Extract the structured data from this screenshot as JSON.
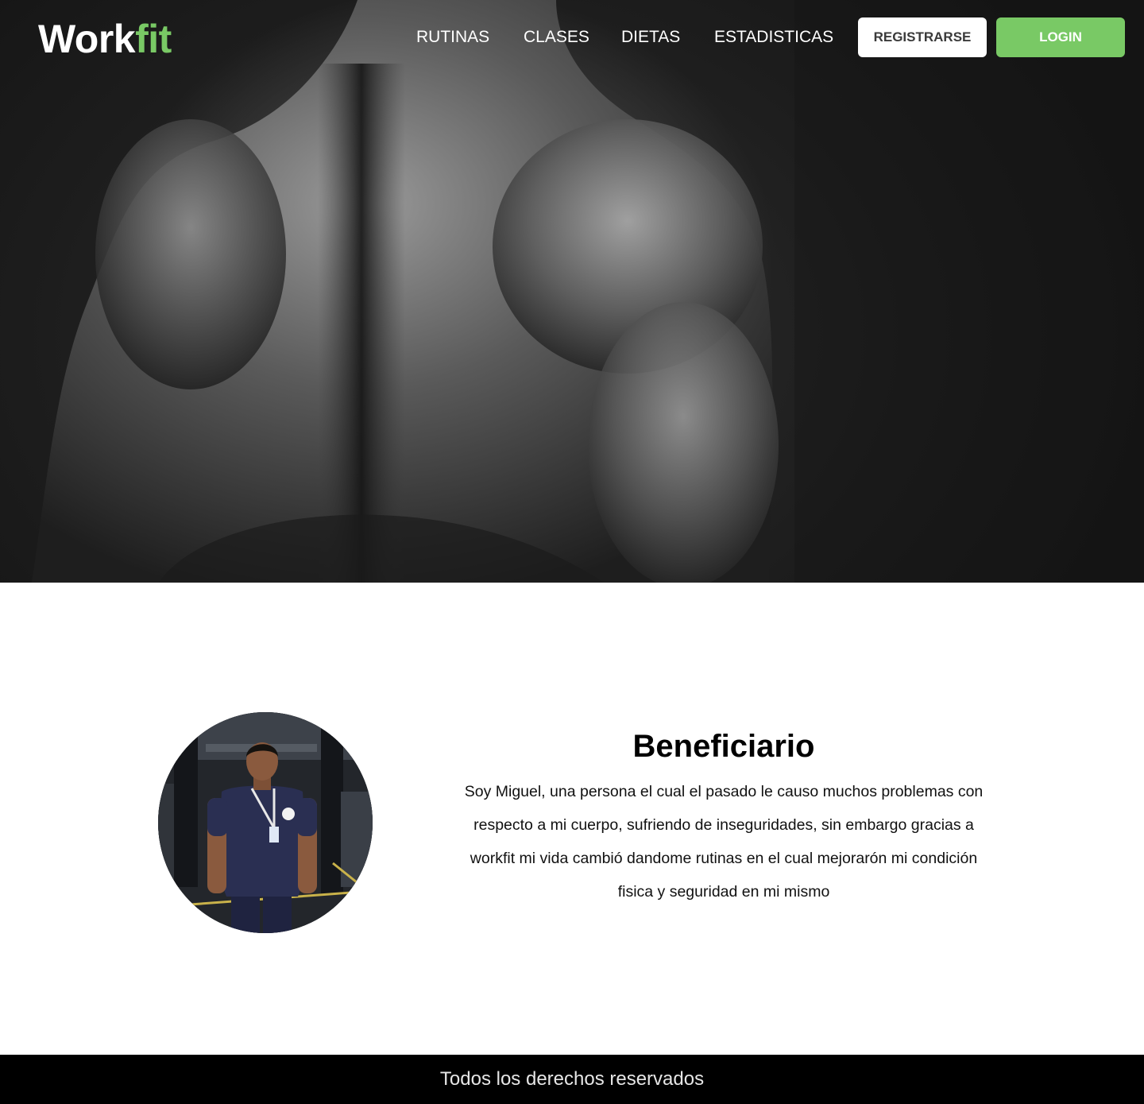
{
  "brand": {
    "name_part1": "Work",
    "name_part2": "fit",
    "accent_color": "#79c965"
  },
  "nav": {
    "items": [
      {
        "label": "RUTINAS"
      },
      {
        "label": "CLASES"
      },
      {
        "label": "DIETAS"
      },
      {
        "label": "ESTADISTICAS"
      }
    ],
    "register_label": "REGISTRARSE",
    "login_label": "LOGIN"
  },
  "hero": {
    "image_icon": "muscular-back-photo"
  },
  "beneficiary": {
    "photo_icon": "person-photo",
    "title": "Beneficiario",
    "text": "Soy Miguel, una persona el cual el pasado le causo muchos problemas con respecto a mi cuerpo,  sufriendo de inseguridades, sin embargo gracias a workfit mi vida cambió dandome rutinas en el cual mejorarón mi condición fisica y seguridad en mi mismo"
  },
  "footer": {
    "text": "Todos los derechos reservados"
  }
}
